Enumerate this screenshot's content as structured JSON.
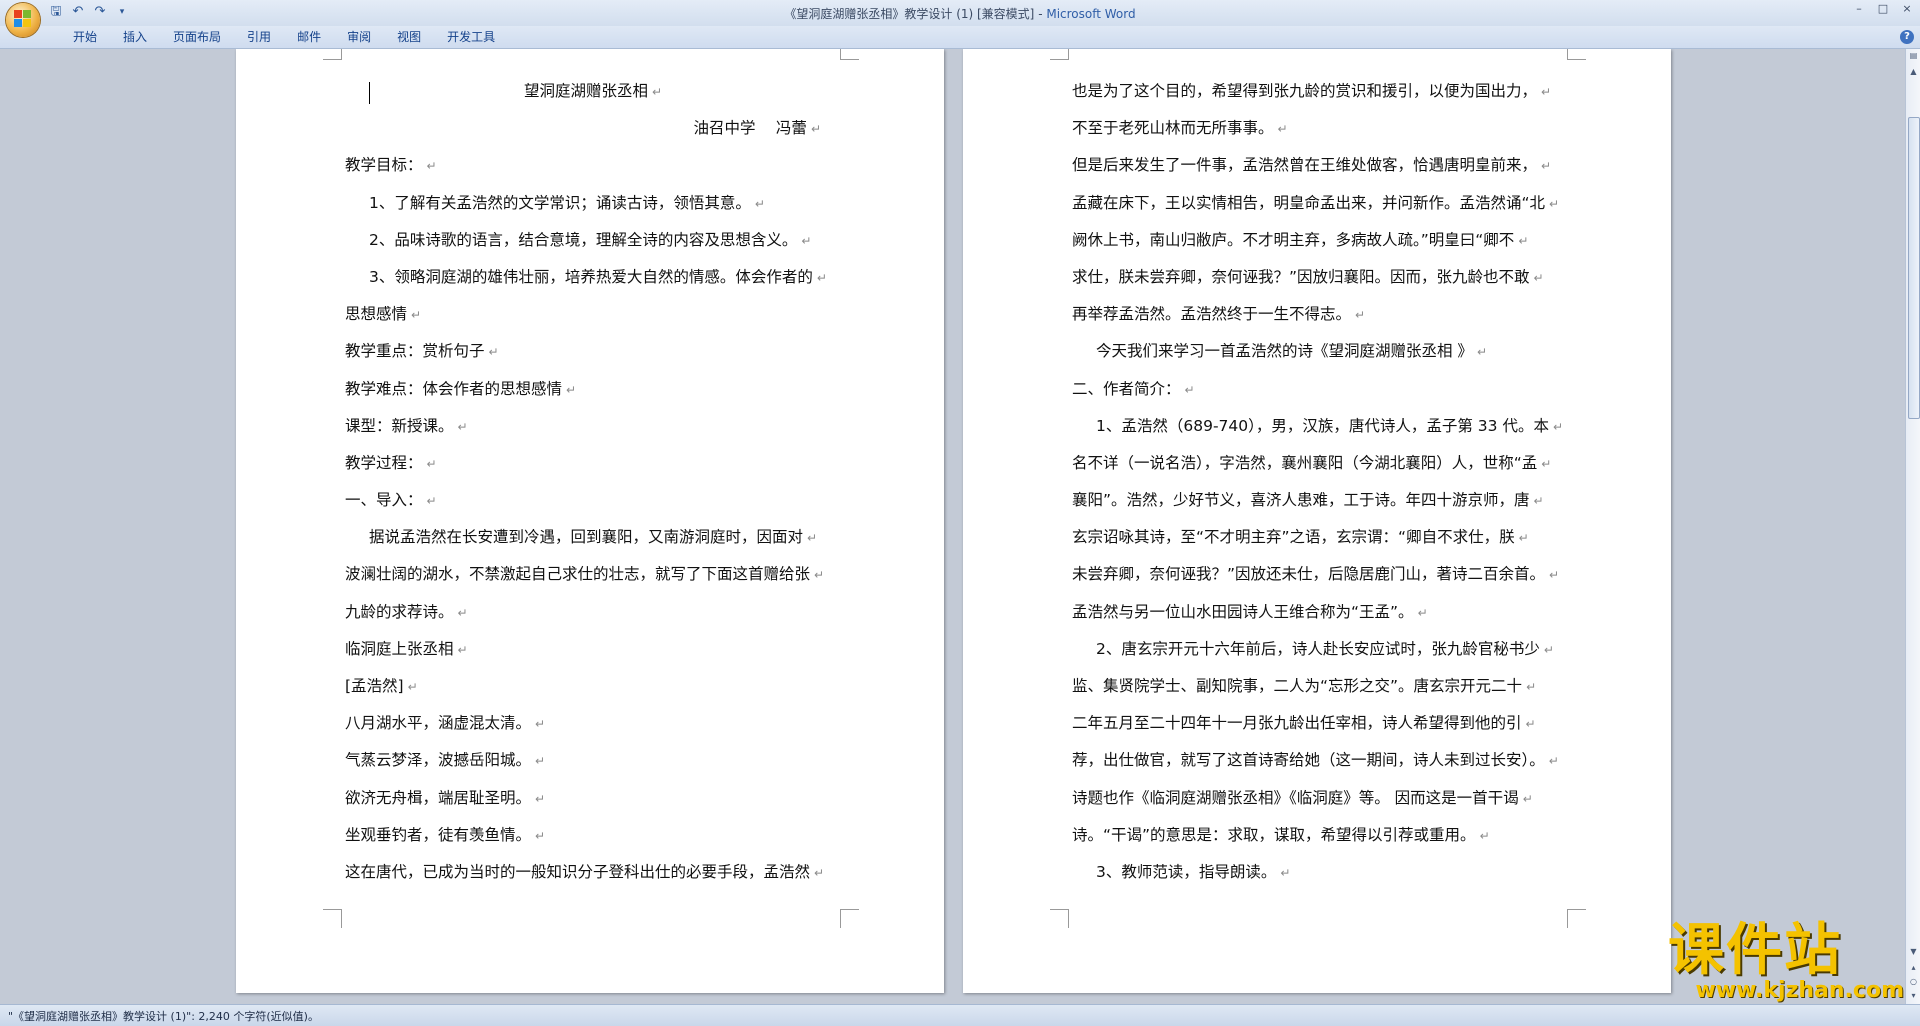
{
  "window": {
    "title_doc": "《望洞庭湖赠张丞相》教学设计 (1) [兼容模式]",
    "title_sep": " - ",
    "title_app": "Microsoft Word",
    "controls": [
      "–",
      "□",
      "×"
    ]
  },
  "ribbon": {
    "tabs": [
      "开始",
      "插入",
      "页面布局",
      "引用",
      "邮件",
      "审阅",
      "视图",
      "开发工具"
    ]
  },
  "page1": {
    "lines": [
      {
        "text": "望洞庭湖赠张丞相",
        "style": "center"
      },
      {
        "text": "油召中学　 冯蕾",
        "style": "right-sig"
      },
      {
        "text": "教学目标：",
        "style": ""
      },
      {
        "text": "1、了解有关孟浩然的文学常识；诵读古诗，领悟其意。",
        "style": "indent"
      },
      {
        "text": "2、品味诗歌的语言，结合意境，理解全诗的内容及思想含义。",
        "style": "indent"
      },
      {
        "text": "3、领略洞庭湖的雄伟壮丽，培养热爱大自然的情感。体会作者的",
        "style": "indent"
      },
      {
        "text": "思想感情",
        "style": ""
      },
      {
        "text": "教学重点：赏析句子",
        "style": ""
      },
      {
        "text": "教学难点：体会作者的思想感情",
        "style": ""
      },
      {
        "text": "课型：新授课。",
        "style": ""
      },
      {
        "text": "教学过程：",
        "style": ""
      },
      {
        "text": "一、导入：",
        "style": ""
      },
      {
        "text": "据说孟浩然在长安遭到冷遇，回到襄阳，又南游洞庭时，因面对",
        "style": "indent"
      },
      {
        "text": "波澜壮阔的湖水，不禁激起自己求仕的壮志，就写了下面这首赠给张",
        "style": ""
      },
      {
        "text": "九龄的求荐诗。",
        "style": ""
      },
      {
        "text": "临洞庭上张丞相",
        "style": ""
      },
      {
        "text": "[孟浩然]",
        "style": ""
      },
      {
        "text": "八月湖水平，涵虚混太清。",
        "style": ""
      },
      {
        "text": "气蒸云梦泽，波撼岳阳城。",
        "style": ""
      },
      {
        "text": "欲济无舟楫，端居耻圣明。",
        "style": ""
      },
      {
        "text": "坐观垂钓者，徒有羡鱼情。",
        "style": ""
      },
      {
        "text": "这在唐代，已成为当时的一般知识分子登科出仕的必要手段，孟浩然",
        "style": ""
      }
    ]
  },
  "page2": {
    "lines": [
      {
        "text": "也是为了这个目的，希望得到张九龄的赏识和援引，以便为国出力，",
        "style": ""
      },
      {
        "text": "不至于老死山林而无所事事。",
        "style": ""
      },
      {
        "text": "但是后来发生了一件事，孟浩然曾在王维处做客，恰遇唐明皇前来，",
        "style": ""
      },
      {
        "text": "孟藏在床下，王以实情相告，明皇命孟出来，并问新作。孟浩然诵“北",
        "style": ""
      },
      {
        "text": "阙休上书，南山归敝庐。不才明主弃，多病故人疏。”明皇曰“卿不",
        "style": ""
      },
      {
        "text": "求仕，朕未尝弃卿，奈何诬我？”因放归襄阳。因而，张九龄也不敢",
        "style": ""
      },
      {
        "text": "再举荐孟浩然。孟浩然终于一生不得志。",
        "style": ""
      },
      {
        "text": "今天我们来学习一首孟浩然的诗《望洞庭湖赠张丞相 》",
        "style": "indent"
      },
      {
        "text": "二、作者简介：",
        "style": ""
      },
      {
        "text": "1、孟浩然（689-740），男，汉族，唐代诗人，孟子第 33 代。本",
        "style": "indent"
      },
      {
        "text": "名不详（一说名浩），字浩然，襄州襄阳（今湖北襄阳）人，世称“孟",
        "style": ""
      },
      {
        "text": "襄阳”。浩然，少好节义，喜济人患难，工于诗。年四十游京师，唐",
        "style": ""
      },
      {
        "text": "玄宗诏咏其诗，至“不才明主弃”之语，玄宗谓：“卿自不求仕，朕",
        "style": ""
      },
      {
        "text": "未尝弃卿，奈何诬我？”因放还未仕，后隐居鹿门山，著诗二百余首。",
        "style": ""
      },
      {
        "text": "孟浩然与另一位山水田园诗人王维合称为“王孟”。",
        "style": ""
      },
      {
        "text": "2、唐玄宗开元十六年前后，诗人赴长安应试时，张九龄官秘书少",
        "style": "indent"
      },
      {
        "text": "监、集贤院学士、副知院事，二人为“忘形之交”。唐玄宗开元二十",
        "style": ""
      },
      {
        "text": "二年五月至二十四年十一月张九龄出任宰相，诗人希望得到他的引",
        "style": ""
      },
      {
        "text": "荐，出仕做官，就写了这首诗寄给她（这一期间，诗人未到过长安）。",
        "style": ""
      },
      {
        "text": "诗题也作《临洞庭湖赠张丞相》《临洞庭》等。 因而这是一首干谒",
        "style": ""
      },
      {
        "text": "诗。“干谒”的意思是：求取，谋取，希望得以引荐或重用。",
        "style": ""
      },
      {
        "text": "3、教师范读，指导朗读。",
        "style": "indent"
      }
    ]
  },
  "statusbar": {
    "text": "\"《望洞庭湖赠张丞相》教学设计 (1)\": 2,240 个字符(近似值)。"
  },
  "watermark": {
    "title": "课件站",
    "url": "www.kjzhan.com"
  },
  "icons": {
    "save": "save-icon",
    "undo": "undo-icon",
    "redo": "redo-icon",
    "help": "help-icon"
  }
}
